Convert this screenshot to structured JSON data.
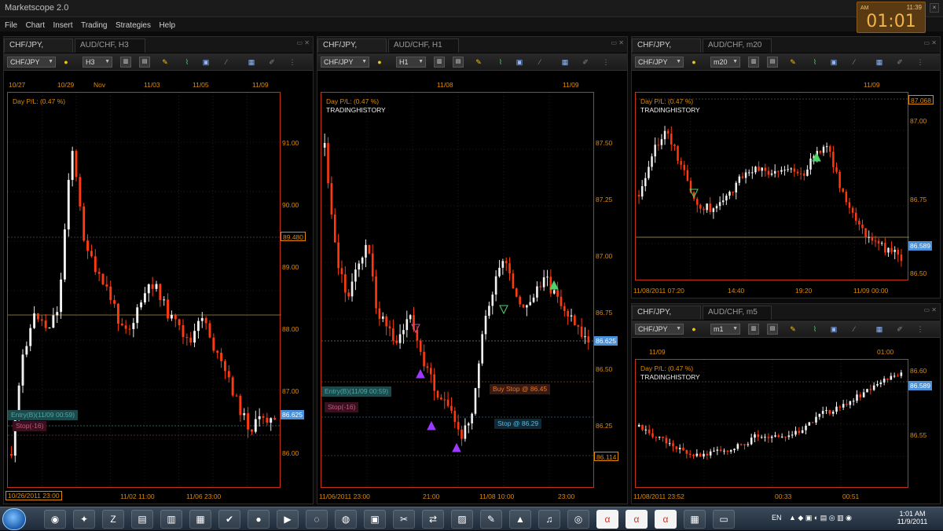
{
  "app": {
    "title": "Marketscope 2.0"
  },
  "menu": [
    "File",
    "Chart",
    "Insert",
    "Trading",
    "Strategies",
    "Help"
  ],
  "clock": {
    "top_time": "11:39",
    "time": "01:01",
    "am": "AM"
  },
  "panels": [
    {
      "tabs": [
        "CHF/JPY, H3",
        "AUD/CHF, H3"
      ],
      "instrument": "CHF/JPY",
      "period": "H3",
      "top_dates": [
        "10/27",
        "10/29",
        "Nov",
        "11/03",
        "11/05",
        "11/09"
      ],
      "day_pl": "Day P/L: (0.47 %)",
      "y_labels": [
        "91.00",
        "90.00",
        "89.00",
        "88.00",
        "87.00",
        "86.00"
      ],
      "y_tags": [
        "89.480",
        "86.625"
      ],
      "x_labels": [
        "10/26/2011 23:00",
        "11/02 11:00",
        "11/06 23:00"
      ],
      "annotations": [
        "Entry(B)(11/09 00:59)",
        "Stop(-16)"
      ]
    },
    {
      "tabs": [
        "CHF/JPY, H1",
        "AUD/CHF, H1"
      ],
      "instrument": "CHF/JPY",
      "period": "H1",
      "top_dates": [
        "11/08",
        "11/09"
      ],
      "day_pl": "Day P/L: (0.47 %)",
      "source": "TRADINGHISTORY",
      "y_labels": [
        "87.50",
        "87.25",
        "87.00",
        "86.75",
        "86.50",
        "86.25"
      ],
      "y_tags": [
        "86.625",
        "86.114"
      ],
      "x_labels": [
        "11/06/2011 23:00",
        "21:00",
        "11/08 10:00",
        "23:00"
      ],
      "annotations": [
        "Entry(B)(11/09 00:59)",
        "Stop(-16)",
        "Buy Stop @ 86.45",
        "Stop @ 86.29"
      ]
    },
    {
      "tabs": [
        "CHF/JPY, m20",
        "AUD/CHF, m20"
      ],
      "instrument": "CHF/JPY",
      "period": "m20",
      "top_dates": [
        "11/09"
      ],
      "day_pl": "Day P/L: (0.47 %)",
      "source": "TRADINGHISTORY",
      "y_labels": [
        "87.00",
        "86.75",
        "86.50"
      ],
      "y_tags": [
        "87.068",
        "86.589"
      ],
      "x_labels": [
        "11/08/2011 07:20",
        "14:40",
        "19:20",
        "11/09 00:00"
      ]
    },
    {
      "tabs": [
        "CHF/JPY, m1",
        "AUD/CHF, m5"
      ],
      "instrument": "CHF/JPY",
      "period": "m1",
      "top_dates": [
        "11/09",
        "01:00"
      ],
      "day_pl": "Day P/L: (0.47 %)",
      "source": "TRADINGHISTORY",
      "y_labels": [
        "86.60",
        "86.55"
      ],
      "y_tags": [
        "86.589"
      ],
      "x_labels": [
        "11/08/2011 23:52",
        "00:33",
        "00:51"
      ]
    }
  ],
  "taskbar": {
    "language": "EN",
    "time": "1:01 AM",
    "date": "11/9/2011",
    "apps": [
      "firefox-icon",
      "finder-icon",
      "zf-icon",
      "folder-icon",
      "folder2-icon",
      "calculator-icon",
      "tortoise-icon",
      "orange-icon",
      "media-icon",
      "swirl-icon",
      "chrome-icon",
      "network-icon",
      "scissors-icon",
      "sync-icon",
      "photo-icon",
      "paint-icon",
      "pdf-icon",
      "itunes-icon",
      "disc-icon",
      "alpari-icon-1",
      "alpari-icon-2",
      "alpari-icon-3",
      "grid-icon",
      "monitor-icon"
    ],
    "alpari_label": "alpari"
  }
}
